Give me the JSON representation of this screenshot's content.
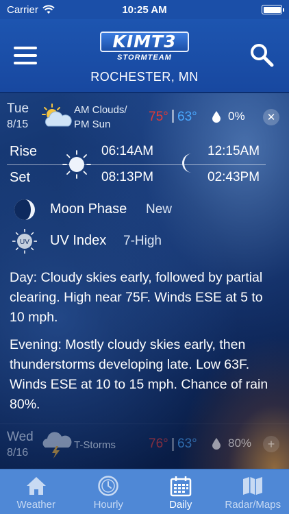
{
  "status_bar": {
    "carrier": "Carrier",
    "time": "10:25 AM"
  },
  "header": {
    "logo_main": "KIMT3",
    "logo_sub": "STORMTEAM",
    "location": "ROCHESTER, MN"
  },
  "today": {
    "day": "Tue",
    "date": "8/15",
    "condition_line1": "AM Clouds/",
    "condition_line2": "PM Sun",
    "condition_icon": "partly-cloudy-icon",
    "high": "75°",
    "separator": "|",
    "low": "63°",
    "precip": "0%",
    "close_label": "✕"
  },
  "sun_moon": {
    "rise_label": "Rise",
    "set_label": "Set",
    "sunrise": "06:14AM",
    "sunset": "08:13PM",
    "moonrise": "12:15AM",
    "moonset": "02:43PM"
  },
  "moon_phase": {
    "label": "Moon Phase",
    "value": "New"
  },
  "uv_index": {
    "label": "UV Index",
    "value": "7-High",
    "icon_text": "UV"
  },
  "descriptions": {
    "day": "Day: Cloudy skies early, followed by partial clearing. High near 75F. Winds ESE at 5 to 10 mph.",
    "evening": "Evening: Mostly cloudy skies early, then thunderstorms developing late. Low 63F. Winds ESE at 10 to 15 mph. Chance of rain 80%."
  },
  "next_day": {
    "day": "Wed",
    "date": "8/16",
    "condition": "T-Storms",
    "condition_icon": "thunderstorm-icon",
    "high": "76°",
    "separator": "|",
    "low": "63°",
    "precip": "80%",
    "expand_label": "+"
  },
  "tabs": [
    {
      "label": "Weather",
      "icon": "home-icon",
      "active": false
    },
    {
      "label": "Hourly",
      "icon": "clock-icon",
      "active": false
    },
    {
      "label": "Daily",
      "icon": "calendar-icon",
      "active": true
    },
    {
      "label": "Radar/Maps",
      "icon": "map-icon",
      "active": false
    }
  ],
  "colors": {
    "high_temp": "#e53935",
    "low_temp": "#4aa8ff",
    "header": "#1b4fa8",
    "tab_bar": "#4f88d6"
  }
}
